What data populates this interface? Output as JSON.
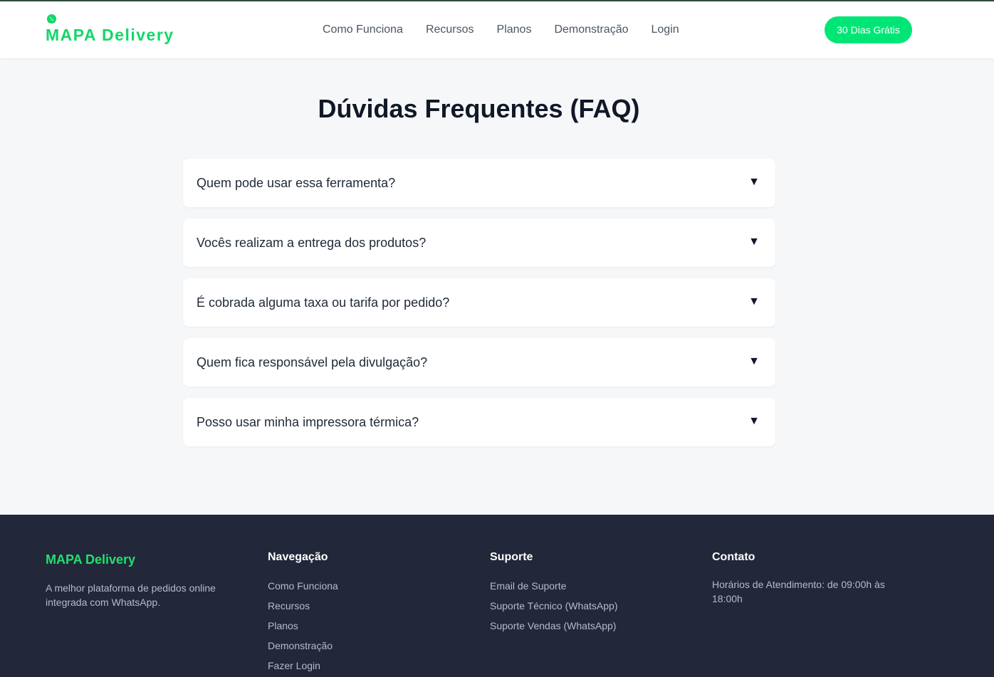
{
  "header": {
    "brand": "MAPA Delivery",
    "logo_icon": "whatsapp-icon",
    "nav": [
      "Como Funciona",
      "Recursos",
      "Planos",
      "Demonstração",
      "Login"
    ],
    "cta_label": "30 Dias Grátis"
  },
  "faq": {
    "title": "Dúvidas Frequentes (FAQ)",
    "arrow": "▼",
    "items": [
      "Quem pode usar essa ferramenta?",
      "Vocês realizam a entrega dos produtos?",
      "É cobrada alguma taxa ou tarifa por pedido?",
      "Quem fica responsável pela divulgação?",
      "Posso usar minha impressora térmica?"
    ]
  },
  "footer": {
    "brand": "MAPA Delivery",
    "description": "A melhor plataforma de pedidos online integrada com WhatsApp.",
    "navigation": {
      "title": "Navegação",
      "links": [
        "Como Funciona",
        "Recursos",
        "Planos",
        "Demonstração",
        "Fazer Login"
      ]
    },
    "support": {
      "title": "Suporte",
      "links": [
        "Email de Suporte",
        "Suporte Técnico (WhatsApp)",
        "Suporte Vendas (WhatsApp)"
      ]
    },
    "contact": {
      "title": "Contato",
      "hours": "Horários de Atendimento: de 09:00h às 18:00h"
    }
  },
  "colors": {
    "brand_green": "#12d867",
    "cta_green": "#00e676",
    "footer_bg": "#222739"
  }
}
